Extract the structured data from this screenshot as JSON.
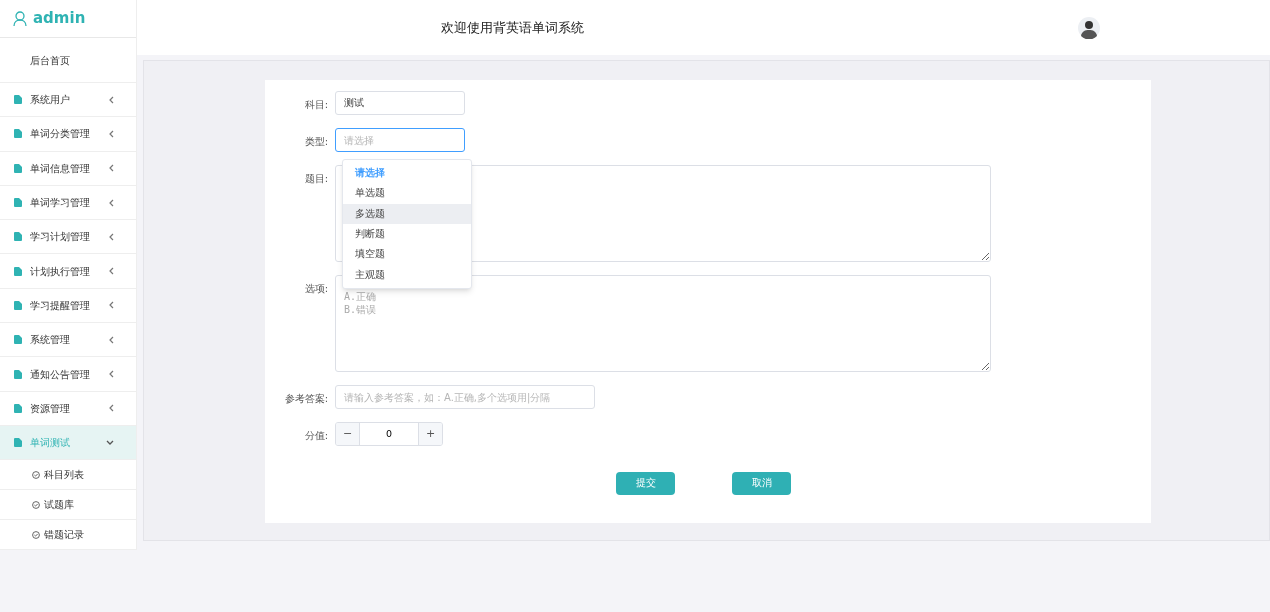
{
  "sidebar": {
    "user": "admin",
    "home": "后台首页",
    "items": [
      {
        "label": "系统用户",
        "expanded": false
      },
      {
        "label": "单词分类管理",
        "expanded": false
      },
      {
        "label": "单词信息管理",
        "expanded": false
      },
      {
        "label": "单词学习管理",
        "expanded": false
      },
      {
        "label": "学习计划管理",
        "expanded": false
      },
      {
        "label": "计划执行管理",
        "expanded": false
      },
      {
        "label": "学习提醒管理",
        "expanded": false
      },
      {
        "label": "系统管理",
        "expanded": false
      },
      {
        "label": "通知公告管理",
        "expanded": false
      },
      {
        "label": "资源管理",
        "expanded": false
      },
      {
        "label": "单词测试",
        "expanded": true,
        "children": [
          {
            "label": "科目列表"
          },
          {
            "label": "试题库"
          },
          {
            "label": "错题记录"
          }
        ]
      }
    ]
  },
  "header": {
    "title": "欢迎使用背英语单词系统"
  },
  "form": {
    "subject": {
      "label": "科目:",
      "value": "测试"
    },
    "type": {
      "label": "类型:",
      "placeholder": "请选择",
      "options": [
        {
          "label": "请选择",
          "selected": true,
          "hovered": false
        },
        {
          "label": "单选题",
          "selected": false,
          "hovered": false
        },
        {
          "label": "多选题",
          "selected": false,
          "hovered": true
        },
        {
          "label": "判断题",
          "selected": false,
          "hovered": false
        },
        {
          "label": "填空题",
          "selected": false,
          "hovered": false
        },
        {
          "label": "主观题",
          "selected": false,
          "hovered": false
        }
      ]
    },
    "question": {
      "label": "题目:"
    },
    "options": {
      "label": "选项:",
      "placeholder": "A.正确\nB.错误"
    },
    "answer": {
      "label": "参考答案:",
      "placeholder": "请输入参考答案，如：A.正确,多个选项用|分隔"
    },
    "score": {
      "label": "分值:",
      "value": "0",
      "minus": "−",
      "plus": "+"
    },
    "buttons": [
      "提交",
      "取消"
    ]
  }
}
